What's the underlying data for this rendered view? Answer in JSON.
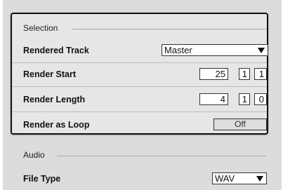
{
  "selection": {
    "title": "Selection",
    "rendered_track": {
      "label": "Rendered Track",
      "value": "Master"
    },
    "render_start": {
      "label": "Render Start",
      "values": [
        "25",
        "1",
        "1"
      ]
    },
    "render_length": {
      "label": "Render Length",
      "values": [
        "4",
        "1",
        "0"
      ]
    },
    "render_as_loop": {
      "label": "Render as Loop",
      "value": "Off"
    }
  },
  "audio": {
    "title": "Audio",
    "file_type": {
      "label": "File Type",
      "value": "WAV"
    }
  }
}
